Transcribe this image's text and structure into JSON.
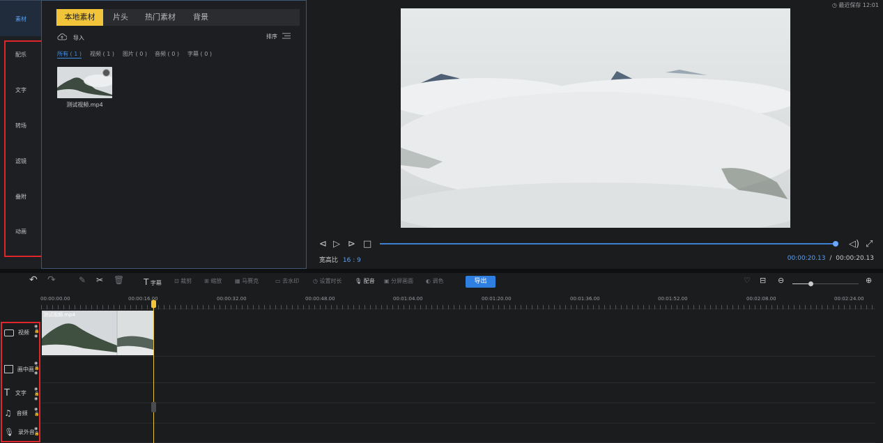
{
  "sidebar": {
    "items": [
      {
        "label": "素材"
      },
      {
        "label": "配乐"
      },
      {
        "label": "文字"
      },
      {
        "label": "转场"
      },
      {
        "label": "滤镜"
      },
      {
        "label": "叠附"
      },
      {
        "label": "动画"
      }
    ]
  },
  "materials": {
    "tabs": [
      "本地素材",
      "片头",
      "热门素材",
      "背景"
    ],
    "import_label": "导入",
    "sort_label": "排序",
    "subtabs": [
      "所有 ( 1 )",
      "视频 ( 1 )",
      "图片 ( 0 )",
      "音频 ( 0 )",
      "字幕 ( 0 )"
    ],
    "file_name": "测试视频.mp4"
  },
  "preview": {
    "autosave": "最近保存 12:01",
    "aspect_label": "宽高比",
    "aspect_value": "16 : 9",
    "time_current": "00:00:20.13",
    "time_sep": "/",
    "time_total": "00:00:20.13"
  },
  "toolbar": {
    "subtitle": "字幕",
    "crop": "裁剪",
    "zoom": "缩放",
    "mosaic": "马赛克",
    "dewatermark": "去水印",
    "set_duration": "设置时长",
    "dubbing": "配音",
    "split_screen": "分屏画面",
    "color": "调色",
    "export": "导出"
  },
  "timeline": {
    "ticks": [
      "00:00:00.00",
      "00:00:16.00",
      "00:00:32.00",
      "00:00:48.00",
      "00:01:04.00",
      "00:01:20.00",
      "00:01:36.00",
      "00:01:52.00",
      "00:02:08.00",
      "00:02:24.00"
    ],
    "tracks": [
      {
        "label": "视频"
      },
      {
        "label": "画中画"
      },
      {
        "label": "文字"
      },
      {
        "label": "音频"
      },
      {
        "label": "录外音"
      }
    ],
    "clip_name": "测试视频.mp4"
  },
  "colors": {
    "accent_yellow": "#f2c43a",
    "accent_blue": "#2f7fe0",
    "annotation_red": "#e0252b"
  }
}
